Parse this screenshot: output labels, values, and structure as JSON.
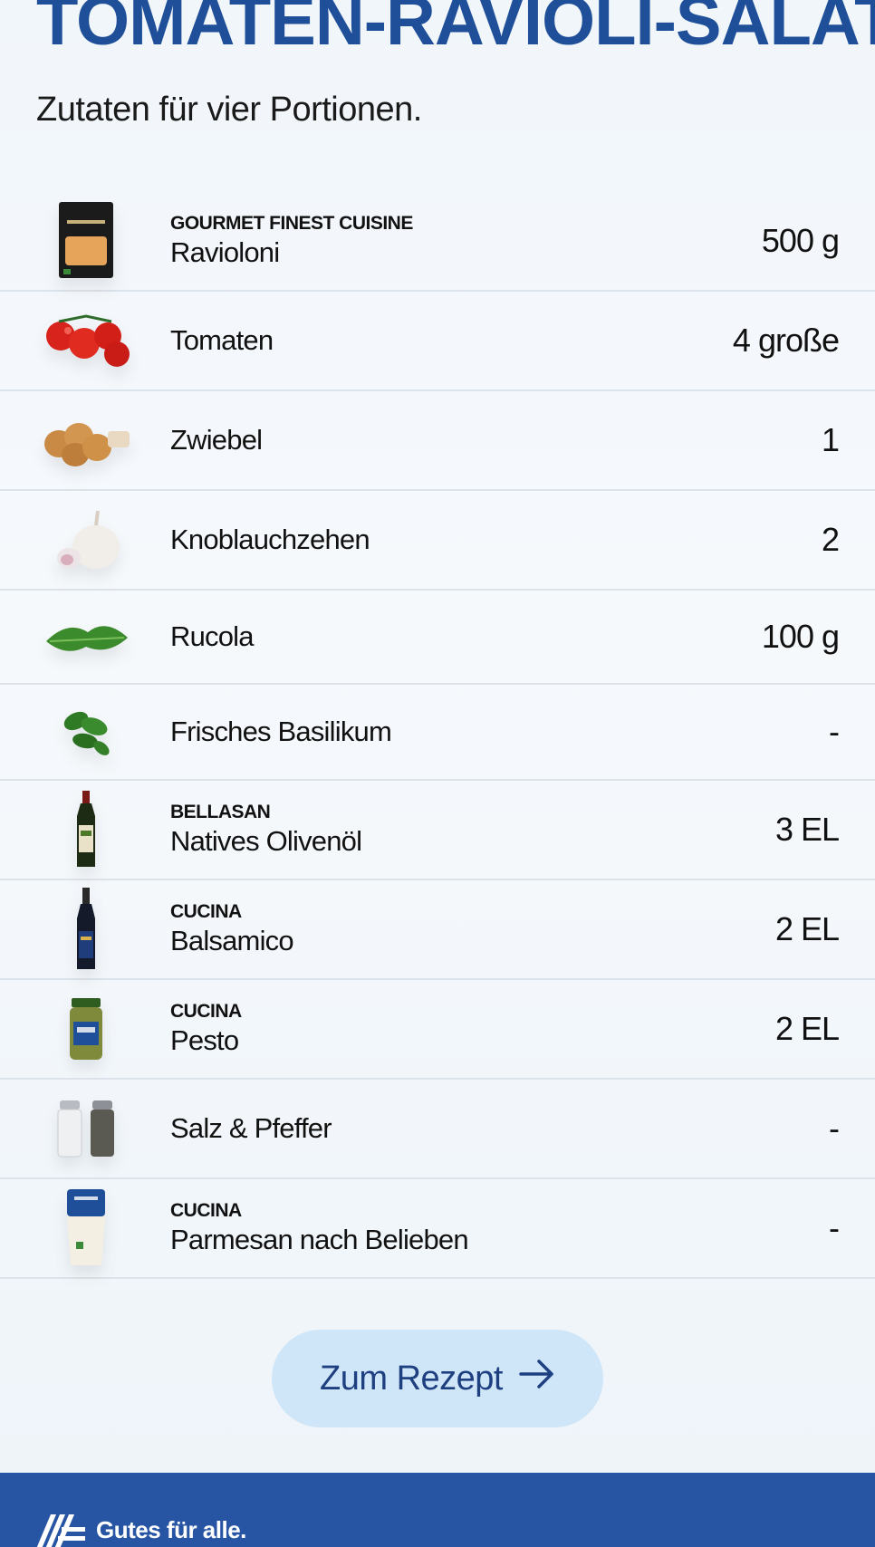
{
  "title": "TOMATEN-RAVIOLI-SALAT",
  "subtitle": "Zutaten für vier Portionen.",
  "ingredients": [
    {
      "brand": "GOURMET FINEST CUISINE",
      "name": "Ravioloni",
      "amount": "500 g",
      "icon": "ravioloni-package-icon"
    },
    {
      "brand": "",
      "name": "Tomaten",
      "amount": "4 große",
      "icon": "tomatoes-icon"
    },
    {
      "brand": "",
      "name": "Zwiebel",
      "amount": "1",
      "icon": "onions-icon"
    },
    {
      "brand": "",
      "name": "Knoblauchzehen",
      "amount": "2",
      "icon": "garlic-icon"
    },
    {
      "brand": "",
      "name": "Rucola",
      "amount": "100 g",
      "icon": "rucola-icon"
    },
    {
      "brand": "",
      "name": "Frisches Basilikum",
      "amount": "-",
      "icon": "basil-icon"
    },
    {
      "brand": "BELLASAN",
      "name": "Natives Olivenöl",
      "amount": "3 EL",
      "icon": "olive-oil-bottle-icon"
    },
    {
      "brand": "CUCINA",
      "name": "Balsamico",
      "amount": "2 EL",
      "icon": "balsamico-bottle-icon"
    },
    {
      "brand": "CUCINA",
      "name": "Pesto",
      "amount": "2 EL",
      "icon": "pesto-jar-icon"
    },
    {
      "brand": "",
      "name": "Salz & Pfeffer",
      "amount": "-",
      "icon": "salt-pepper-shakers-icon"
    },
    {
      "brand": "CUCINA",
      "name": "Parmesan nach Belieben",
      "amount": "-",
      "icon": "parmesan-package-icon"
    }
  ],
  "cta": {
    "label": "Zum Rezept",
    "icon": "arrow-right-icon"
  },
  "footer": {
    "slogan": "Gutes für alle.",
    "logo": "aldi-logo-icon"
  },
  "colors": {
    "title": "#1f4f99",
    "cta_bg": "#cfe6f8",
    "cta_text": "#1e3f80",
    "footer_bg": "#2755a3"
  }
}
